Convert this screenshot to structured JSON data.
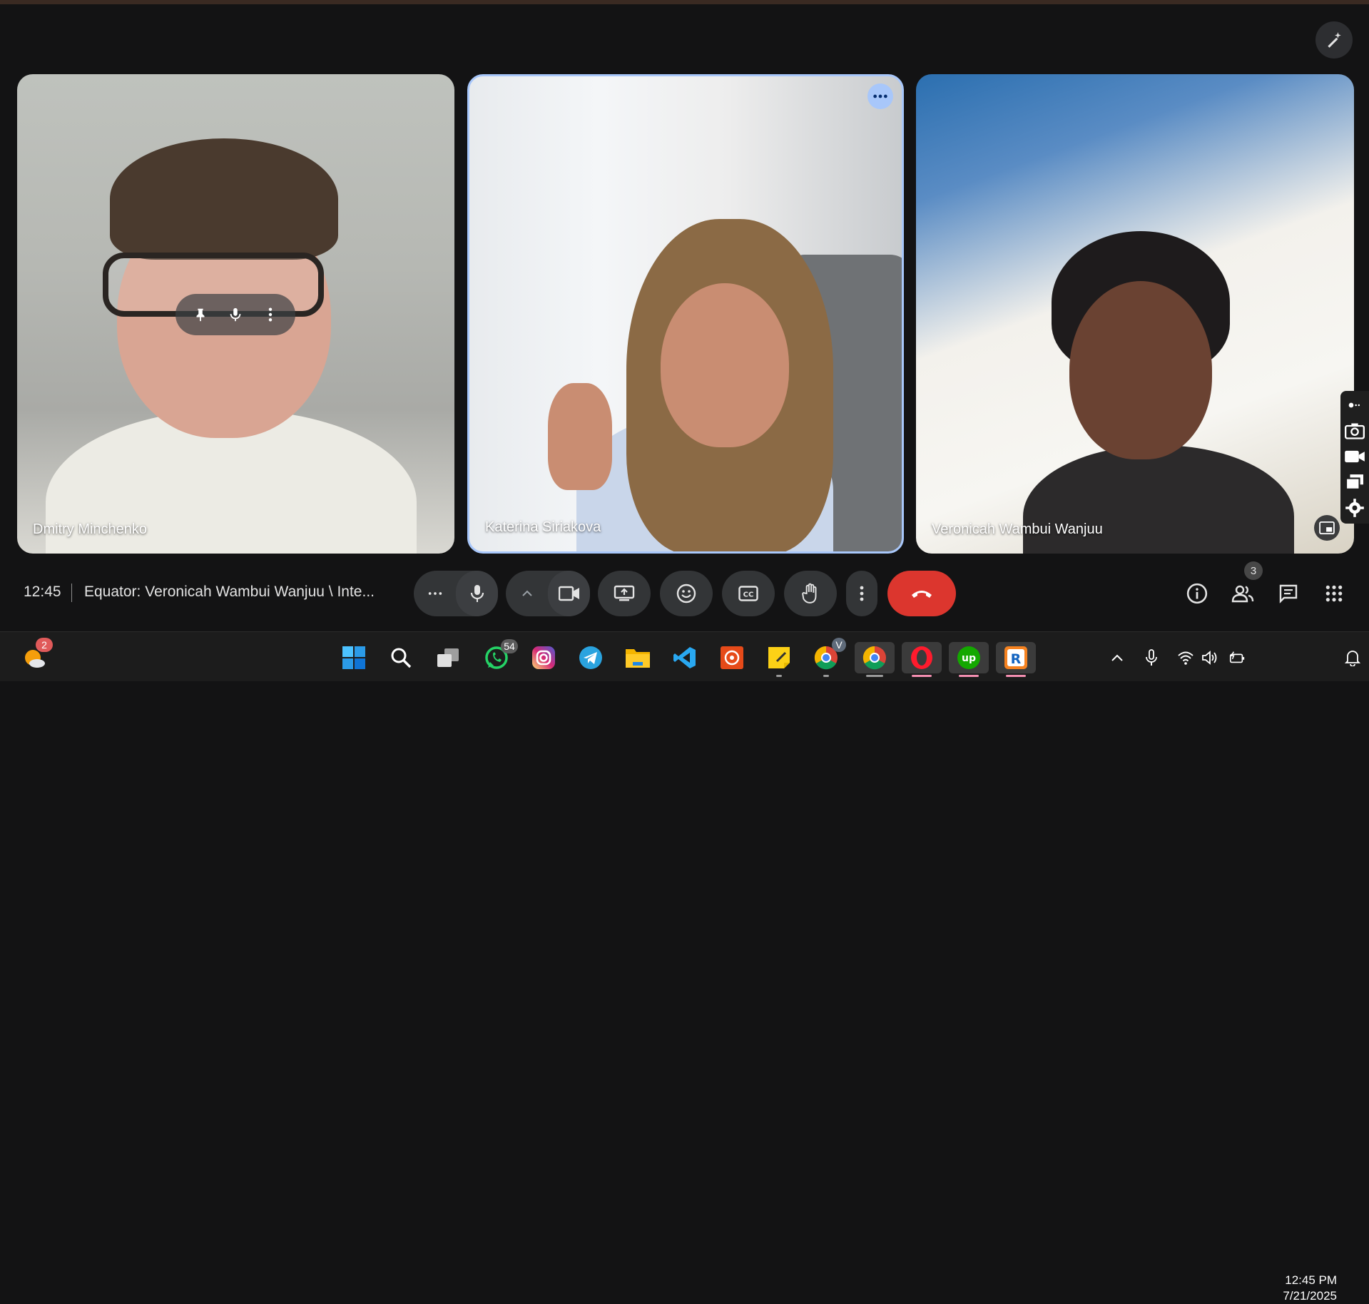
{
  "participants": [
    {
      "name": "Dmitry Minchenko"
    },
    {
      "name": "Katerina Siriakova"
    },
    {
      "name": "Veronicah Wambui Wanjuu"
    }
  ],
  "meeting": {
    "time": "12:45",
    "title": "Equator: Veronicah Wambui Wanjuu \\ Inte...",
    "people_count": "3"
  },
  "icons": {
    "effects": "sparkle-pen-icon",
    "pin": "pin-icon",
    "mic": "microphone-icon",
    "more": "more-vert-icon",
    "camera": "videocam-icon",
    "present": "present-screen-icon",
    "emoji": "emoji-icon",
    "captions": "closed-caption-icon",
    "hand": "raise-hand-icon",
    "end": "call-end-icon",
    "info": "info-icon",
    "people": "people-icon",
    "chat": "chat-icon",
    "activities": "apps-grid-icon"
  },
  "colors": {
    "background": "#131314",
    "control": "#333537",
    "end_call": "#dc362e",
    "speaking_border": "#a8c7fa"
  },
  "taskbar": {
    "weather_badge": "2",
    "whatsapp_badge": "54",
    "chrome_profile_badge": "V",
    "time": "12:45 PM",
    "date": "7/21/2025"
  }
}
